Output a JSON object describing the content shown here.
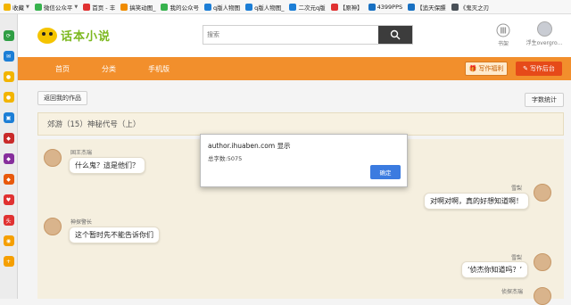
{
  "bookmarks": [
    {
      "label": "收藏",
      "color": "#f2b400"
    },
    {
      "label": "微信公众平",
      "color": "#37b24d"
    },
    {
      "label": "首页 - 丰",
      "color": "#e03131"
    },
    {
      "label": "搞笑动图_",
      "color": "#f08c00"
    },
    {
      "label": "我的公众号",
      "color": "#37b24d"
    },
    {
      "label": "q版人物图",
      "color": "#1c7ed6"
    },
    {
      "label": "q版人物图_",
      "color": "#1c7ed6"
    },
    {
      "label": "二次元q版",
      "color": "#1c7ed6"
    },
    {
      "label": "【原神】",
      "color": "#e03131"
    },
    {
      "label": "4399PPS",
      "color": "#1971c2"
    },
    {
      "label": "【追天保膘",
      "color": "#1971c2"
    },
    {
      "label": "《鬼灭之刃",
      "color": "#495057"
    }
  ],
  "sidebar": [
    {
      "icon": "refresh-icon",
      "color": "#2f9e44"
    },
    {
      "icon": "mail-icon",
      "color": "#1c7ed6"
    },
    {
      "icon": "chat-icon",
      "color": "#f2b400"
    },
    {
      "icon": "chat-bubble-icon",
      "color": "#f2b400"
    },
    {
      "icon": "tv-icon",
      "color": "#1c7ed6"
    },
    {
      "icon": "game-icon",
      "color": "#c92a2a"
    },
    {
      "icon": "game-icon",
      "color": "#862e9c"
    },
    {
      "icon": "game-icon",
      "color": "#e8590c"
    },
    {
      "icon": "heart-icon",
      "color": "#e03131"
    },
    {
      "icon": "toutiao-icon",
      "color": "#e03131"
    },
    {
      "icon": "weibo-icon",
      "color": "#f59f00"
    },
    {
      "icon": "plus-icon",
      "color": "#f59f00"
    }
  ],
  "header": {
    "logo_text": "话本小说",
    "search_placeholder": "搜索",
    "shelf_label": "书架",
    "user_name": "浮生overgro..."
  },
  "nav": {
    "items": [
      "首页",
      "分类",
      "手机版"
    ],
    "welfare_label": "写作福利",
    "backend_label": "写作后台"
  },
  "content": {
    "back_button": "返回我的作品",
    "count_button": "字数统计",
    "work_title": "郊游（15）神秘代号（上）"
  },
  "messages": [
    {
      "side": "left",
      "name": "固王杰瑞",
      "text": "什么鬼？這是他们？"
    },
    {
      "side": "right",
      "name": "雪梨",
      "text": "对啊对啊，真的好想知道啊！"
    },
    {
      "side": "left",
      "name": "神探警长",
      "text": "这个暂时先不能告诉你们"
    },
    {
      "side": "right",
      "name": "雪梨",
      "text": "‘侦杰你知道吗？’"
    },
    {
      "side": "right",
      "name": "侦探杰瑞",
      "text": ""
    }
  ],
  "dialog": {
    "title": "author.ihuaben.com 显示",
    "message": "总字数:5075",
    "ok_label": "确定"
  },
  "colors": {
    "nav_orange": "#f28f2c",
    "backend_red": "#e64a19",
    "chat_bg": "#f5efdf",
    "dialog_blue": "#3b7be0"
  }
}
